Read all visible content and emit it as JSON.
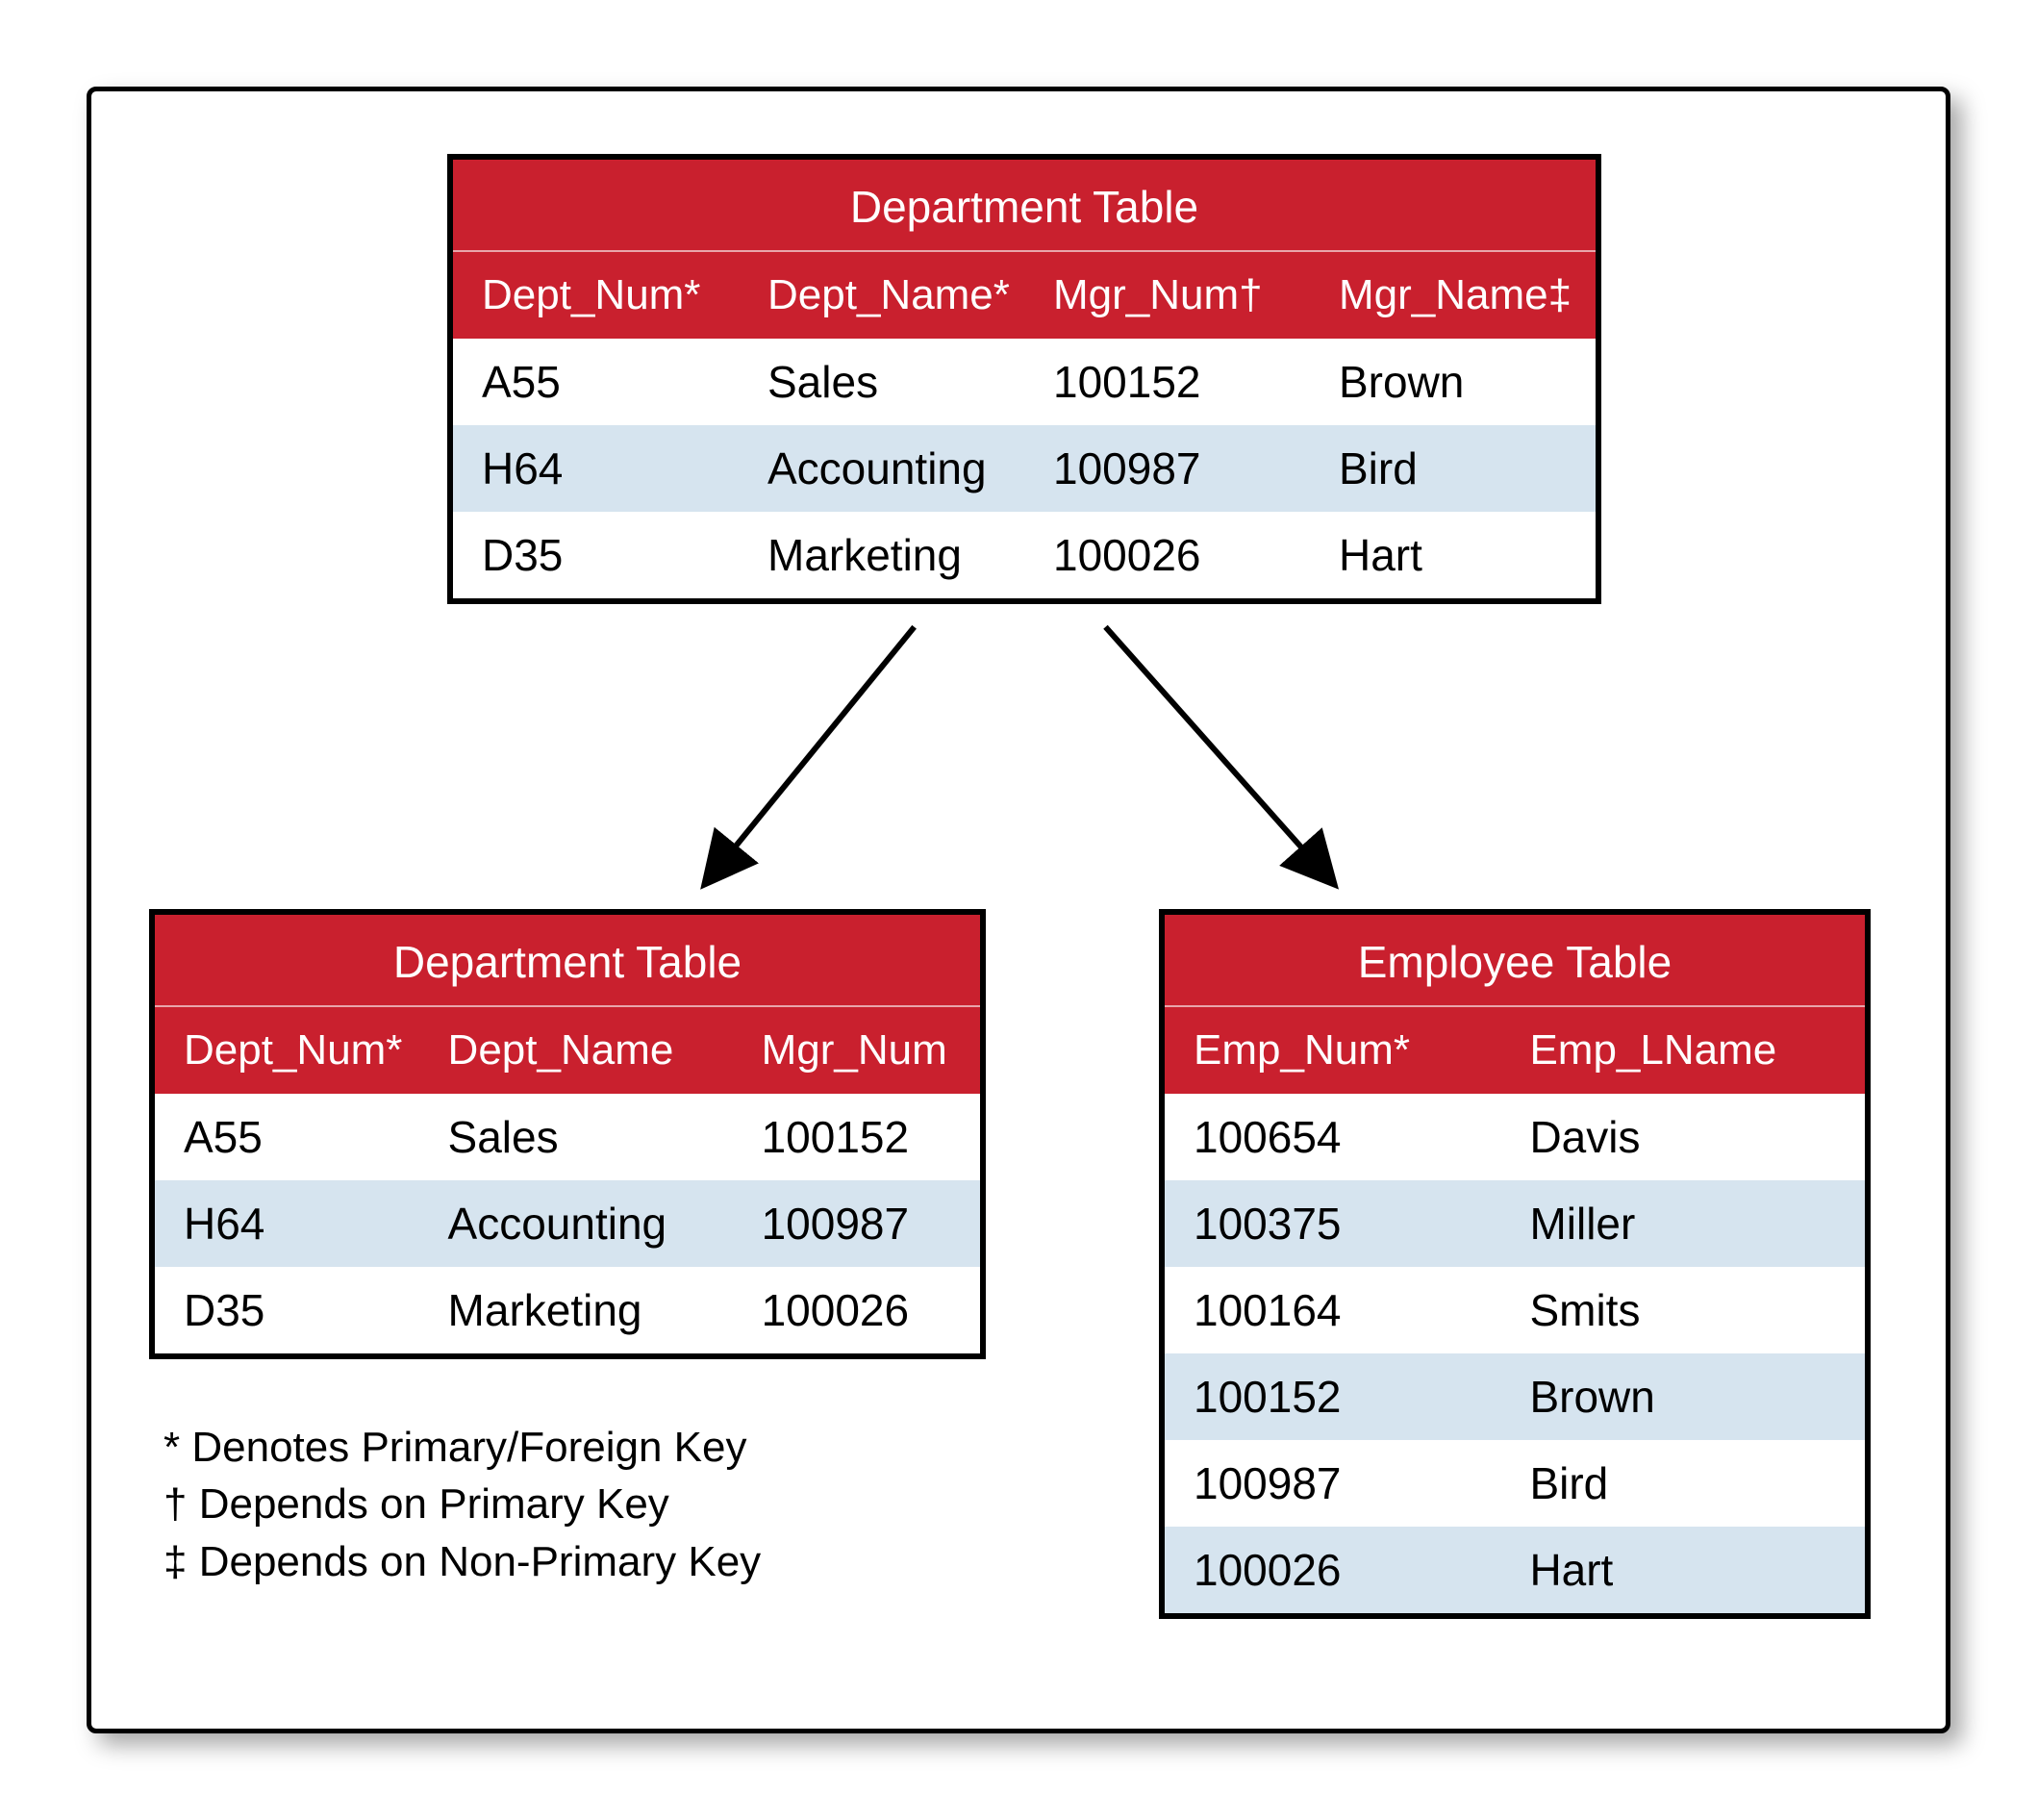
{
  "top_table": {
    "title": "Department Table",
    "headers": [
      "Dept_Num*",
      "Dept_Name*",
      "Mgr_Num†",
      "Mgr_Name‡"
    ],
    "rows": [
      [
        "A55",
        "Sales",
        "100152",
        "Brown"
      ],
      [
        "H64",
        "Accounting",
        "100987",
        "Bird"
      ],
      [
        "D35",
        "Marketing",
        "100026",
        "Hart"
      ]
    ]
  },
  "left_table": {
    "title": "Department Table",
    "headers": [
      "Dept_Num*",
      "Dept_Name",
      "Mgr_Num"
    ],
    "rows": [
      [
        "A55",
        "Sales",
        "100152"
      ],
      [
        "H64",
        "Accounting",
        "100987"
      ],
      [
        "D35",
        "Marketing",
        "100026"
      ]
    ]
  },
  "right_table": {
    "title": "Employee Table",
    "headers": [
      "Emp_Num*",
      "Emp_LName"
    ],
    "rows": [
      [
        "100654",
        "Davis"
      ],
      [
        "100375",
        "Miller"
      ],
      [
        "100164",
        "Smits"
      ],
      [
        "100152",
        "Brown"
      ],
      [
        "100987",
        "Bird"
      ],
      [
        "100026",
        "Hart"
      ]
    ]
  },
  "legend": {
    "l1": "* Denotes Primary/Foreign Key",
    "l2": "† Depends on Primary Key",
    "l3": "‡ Depends on Non-Primary Key"
  }
}
